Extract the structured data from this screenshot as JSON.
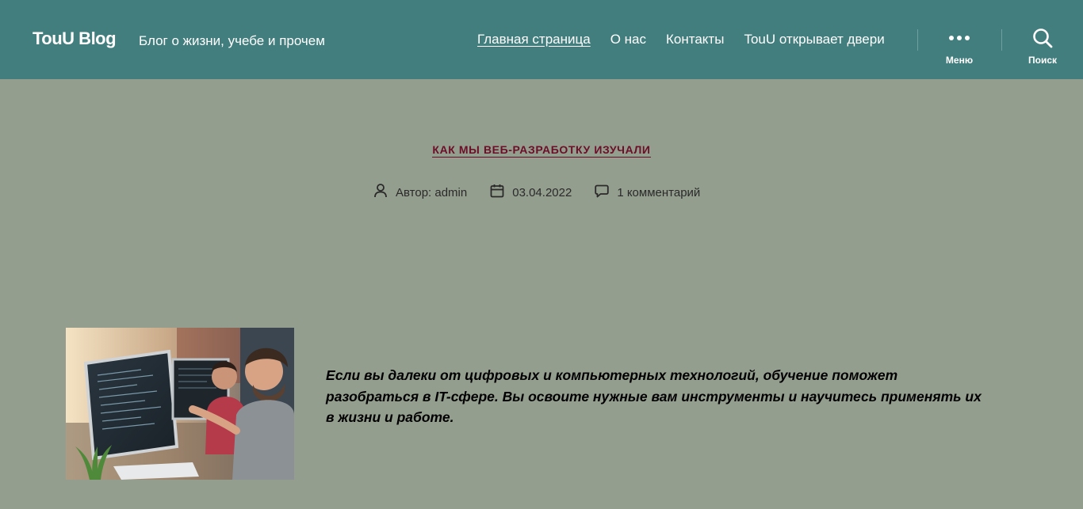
{
  "header": {
    "site_title": "TouU Blog",
    "site_description": "Блог о жизни, учебе и прочем",
    "nav": [
      {
        "label": "Главная страница",
        "current": true
      },
      {
        "label": "О нас",
        "current": false
      },
      {
        "label": "Контакты",
        "current": false
      },
      {
        "label": "TouU открывает двери",
        "current": false
      }
    ],
    "menu_label": "Меню",
    "search_label": "Поиск"
  },
  "post": {
    "category": "КАК МЫ ВЕБ-РАЗРАБОТКУ ИЗУЧАЛИ",
    "author": "Автор: admin",
    "date": "03.04.2022",
    "comments": "1 комментарий",
    "excerpt": "Если вы далеки от цифровых и компьютерных технологий, обучение поможет разобраться в IT-сфере. Вы освоите нужные вам инструменты и научитесь применять их в жизни и работе."
  },
  "colors": {
    "header_bg": "#427e7e",
    "page_bg": "#949e8e",
    "accent": "#6b0e27"
  }
}
